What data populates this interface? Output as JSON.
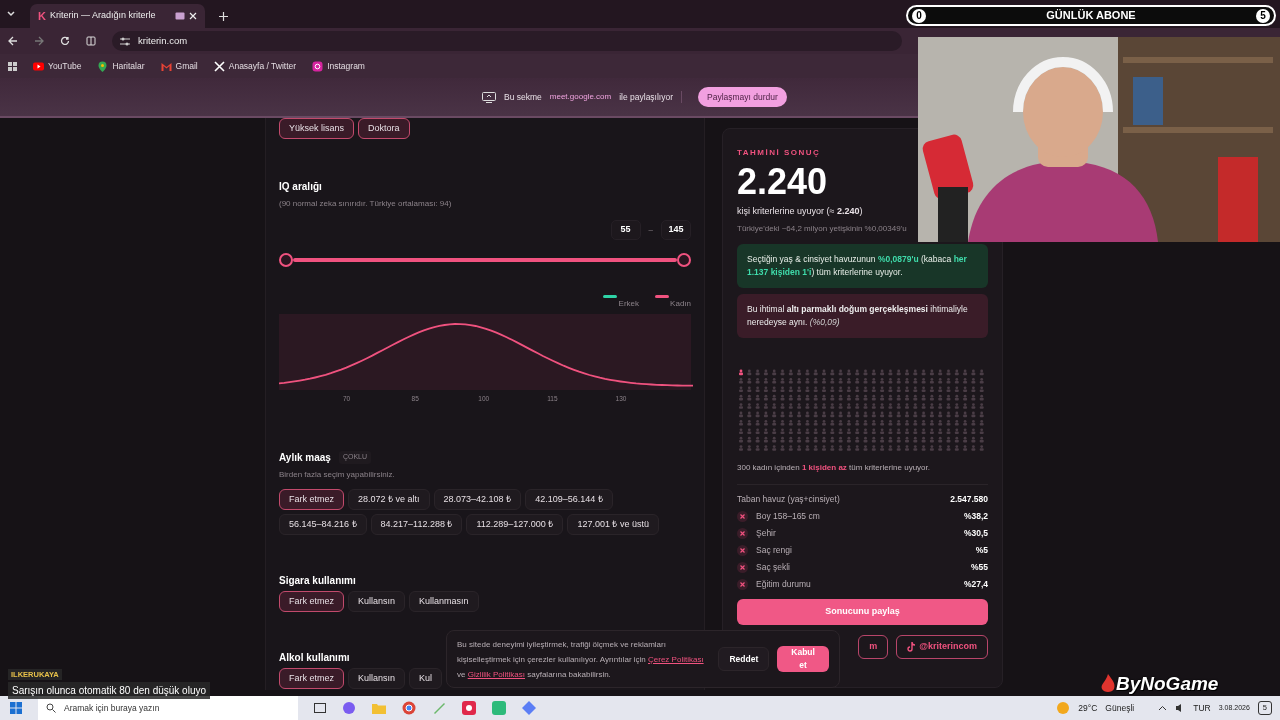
{
  "browser": {
    "favicon": "K",
    "tab_title": "Kriterin — Aradığın kriterle",
    "address": "kriterin.com",
    "bookmarks": [
      {
        "label": "YouTube",
        "kind": "youtube"
      },
      {
        "label": "Haritalar",
        "kind": "maps"
      },
      {
        "label": "Gmail",
        "kind": "mail"
      },
      {
        "label": "Anasayfa / Twitter",
        "kind": "x"
      },
      {
        "label": "Instagram",
        "kind": "instagram"
      }
    ]
  },
  "share_bar": {
    "before": "Bu sekme",
    "host": "meet.google.com",
    "after": "ile paylaşılıyor",
    "button": "Paylaşmayı durdur"
  },
  "education_chips": [
    {
      "label": "Yüksek lisans",
      "selected": true
    },
    {
      "label": "Doktora",
      "selected": true
    }
  ],
  "iq": {
    "title": "IQ aralığı",
    "note": "(90 normal zeka sınırıdır. Türkiye ortalaması: 94)",
    "min": "55",
    "dash": "–",
    "max": "145",
    "range": {
      "low": {
        "level": 0
      },
      "high": {
        "level": 1
      }
    },
    "legend": [
      {
        "label": "Erkek",
        "color": "#2ed3a6"
      },
      {
        "label": "Kadın",
        "color": "#f0527f"
      }
    ],
    "ticks": [
      "70",
      "85",
      "100",
      "115",
      "130"
    ]
  },
  "sections": [
    {
      "title": "Aylık maaş",
      "tag": "ÇOKLU",
      "note": "Birden fazla seçim yapabilirsiniz.",
      "options": [
        {
          "label": "Fark etmez",
          "selected": true
        },
        {
          "label": "28.072 ₺ ve altı",
          "selected": false
        },
        {
          "label": "28.073–42.108 ₺",
          "selected": false
        },
        {
          "label": "42.109–56.144 ₺",
          "selected": false
        },
        {
          "label": "56.145–84.216 ₺",
          "selected": false
        },
        {
          "label": "84.217–112.288 ₺",
          "selected": false
        },
        {
          "label": "112.289–127.000 ₺",
          "selected": false
        },
        {
          "label": "127.001 ₺ ve üstü",
          "selected": false
        }
      ]
    },
    {
      "title": "Sigara kullanımı",
      "options": [
        {
          "label": "Fark etmez",
          "selected": true
        },
        {
          "label": "Kullansın",
          "selected": false
        },
        {
          "label": "Kullanmasın",
          "selected": false
        }
      ]
    },
    {
      "title": "Alkol kullanımı",
      "options": [
        {
          "label": "Fark etmez",
          "selected": true
        },
        {
          "label": "Kullansın",
          "selected": false
        },
        {
          "label": "Kul",
          "selected": false
        }
      ]
    }
  ],
  "result": {
    "eyebrow": "TAHMİNİ SONUÇ",
    "count": "2.240",
    "match_text": "kişi kriterlerine uyuyor (≈ **2.240**)",
    "share_text": "Türkiye'deki ~64,2 milyon yetişkinin %0,00349'u",
    "green_note": "Seçtiğin yaş & cinsiyet havuzunun **%0,0879'u** (kabaca **her 1.137 kişiden 1'i**) tüm kriterlerine uyuyor.",
    "pink_note": "Bu ihtimal **altı parmaklı doğum gerçekleşmesi** ihtimaliyle neredeyse aynı. *(%0,09)*",
    "grid_caption": "300 kadın içinden **1 kişiden az** tüm kriterlerine uyuyor.",
    "base_label": "Taban havuz (yaş+cinsiyet)",
    "base_value": "2.547.580",
    "factors": [
      {
        "label": "Boy 158–165 cm",
        "value": "%38,2"
      },
      {
        "label": "Şehir",
        "value": "%30,5"
      },
      {
        "label": "Saç rengi",
        "value": "%5"
      },
      {
        "label": "Saç şekli",
        "value": "%55"
      },
      {
        "label": "Eğitim durumu",
        "value": "%27,4"
      }
    ],
    "share_button": "Sonucunu paylaş",
    "socials": [
      {
        "label": "m",
        "kind": "plain"
      },
      {
        "label": "@kriterincom",
        "kind": "tiktok"
      }
    ]
  },
  "cookie": {
    "parts": [
      {
        "kind": "text",
        "text": "Bu sitede deneyimi iyileştirmek, trafiği ölçmek ve reklamları kişiselleştirmek için çerezler kullanılıyor. Ayrıntılar için "
      },
      {
        "kind": "link",
        "text": "Çerez Politikası"
      },
      {
        "kind": "text",
        "text": " ve "
      },
      {
        "kind": "link",
        "text": "Gizlilik Politikası"
      },
      {
        "kind": "text",
        "text": " sayfalarına bakabilirsin."
      }
    ],
    "reject": "Reddet",
    "accept": "Kabul et"
  },
  "stream_overlay": {
    "left_count": "0",
    "title": "GÜNLÜK ABONE",
    "right_count": "5",
    "chat_user": "ILKERUKAYA",
    "chat_message": "Sarışın olunca otomatik 80 den düşük oluyo",
    "logo": "ByNoGame"
  },
  "taskbar": {
    "search_placeholder": "Aramak için buraya yazın",
    "temperature": "29°C",
    "weather": "Güneşli",
    "language": "TUR",
    "date": "3.08.2026",
    "notifications": "5"
  }
}
